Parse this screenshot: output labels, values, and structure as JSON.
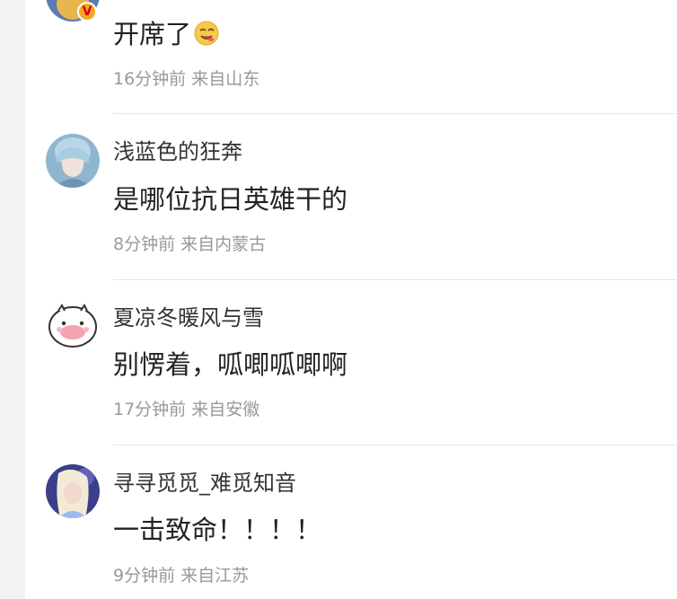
{
  "comments": [
    {
      "username": "",
      "content": "开席了",
      "emoji": "yum-face-emoji",
      "meta": "16分钟前 来自山东",
      "verified_badge": "V"
    },
    {
      "username": "浅蓝色的狂奔",
      "content": "是哪位抗日英雄干的",
      "meta": "8分钟前 来自内蒙古"
    },
    {
      "username": "夏凉冬暖风与雪",
      "content": "别愣着，呱唧呱唧啊",
      "meta": "17分钟前 来自安徽"
    },
    {
      "username": "寻寻觅觅_难觅知音",
      "content": "一击致命！！！！",
      "meta": "9分钟前 来自江苏"
    }
  ],
  "colors": {
    "username": "#333333",
    "content": "#222222",
    "meta": "#999999",
    "divider": "#e6e6e6",
    "gutter": "#f2f2f2"
  }
}
